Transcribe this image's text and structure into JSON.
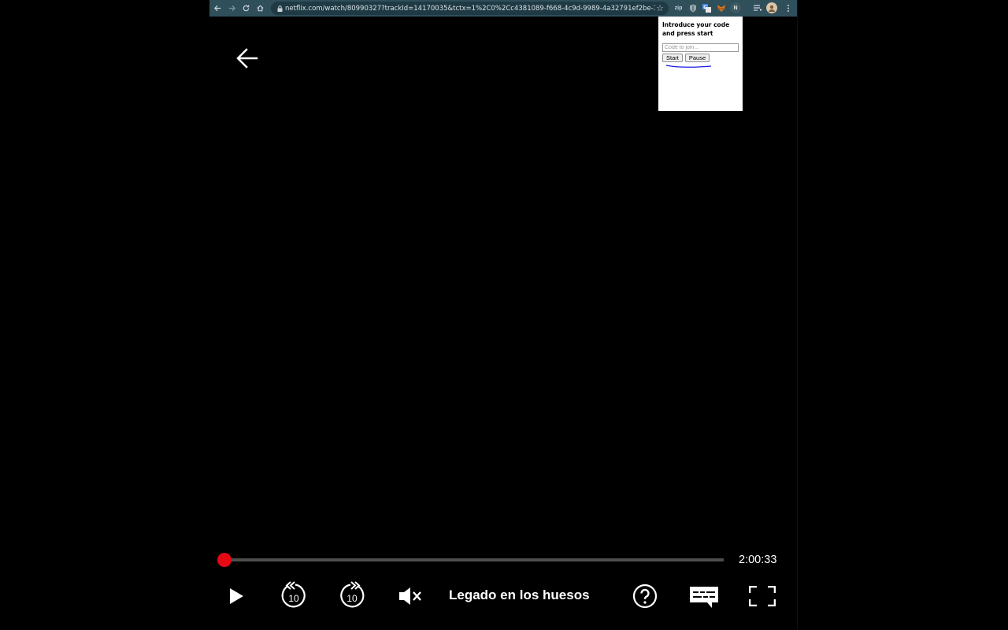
{
  "browser": {
    "url": "netflix.com/watch/80990327?trackId=14170035&tctx=1%2C0%2Cc4381089-f668-4c9d-9989-4a32791ef2be-15041610%2C17...",
    "extensions": [
      "zip-icon",
      "shield-icon",
      "translate-icon",
      "metamask-fox-icon",
      "n-extension-icon",
      "media-playlist-icon",
      "profile-avatar-icon",
      "more-vert-icon"
    ],
    "extension_n_label": "N",
    "extension_zip_label": "zip"
  },
  "popup": {
    "title": "Introduce your code and press start",
    "input_placeholder": "Code to join...",
    "start_label": "Start",
    "pause_label": "Pause"
  },
  "player": {
    "episode_title": "Legado en los huesos",
    "time_remaining": "2:00:33",
    "progress_fraction": 0.0,
    "skip_back_seconds": "10",
    "skip_forward_seconds": "10",
    "colors": {
      "accent": "#e50914",
      "text": "#ffffff",
      "background": "#000000"
    }
  }
}
